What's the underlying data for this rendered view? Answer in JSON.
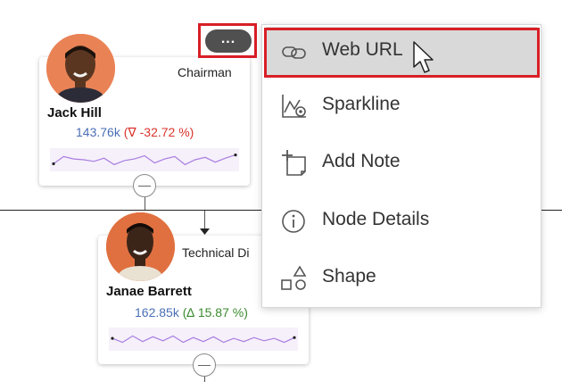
{
  "org_chart": {
    "nodes": [
      {
        "name": "Jack Hill",
        "role": "Chairman",
        "value": "143.76k",
        "change": "(∇ -32.72 %)",
        "trend": "down",
        "sparkline": [
          0.25,
          0.7,
          0.55,
          0.5,
          0.4,
          0.6,
          0.2,
          0.45,
          0.55,
          0.75,
          0.3,
          0.55,
          0.7,
          0.2,
          0.5,
          0.65,
          0.35,
          0.6,
          0.8
        ]
      },
      {
        "name": "Janae Barrett",
        "role": "Technical Di",
        "value": "162.85k",
        "change": "(∆ 15.87 %)",
        "trend": "up",
        "sparkline": [
          0.55,
          0.3,
          0.7,
          0.35,
          0.65,
          0.4,
          0.7,
          0.3,
          0.6,
          0.35,
          0.65,
          0.3,
          0.55,
          0.35,
          0.6,
          0.4,
          0.55,
          0.3,
          0.6
        ]
      }
    ],
    "more_button_label": "...",
    "colors": {
      "negative": "#d9342b",
      "positive": "#3b8a2e",
      "value": "#4a6fb5",
      "sparkline": "#a97de0"
    }
  },
  "context_menu": {
    "items": [
      {
        "label": "Web URL",
        "icon": "link-icon",
        "hovered": true
      },
      {
        "label": "Sparkline",
        "icon": "sparkline-icon"
      },
      {
        "label": "Add Note",
        "icon": "add-note-icon"
      },
      {
        "label": "Node Details",
        "icon": "info-icon"
      },
      {
        "label": "Shape",
        "icon": "shape-icon"
      }
    ]
  }
}
